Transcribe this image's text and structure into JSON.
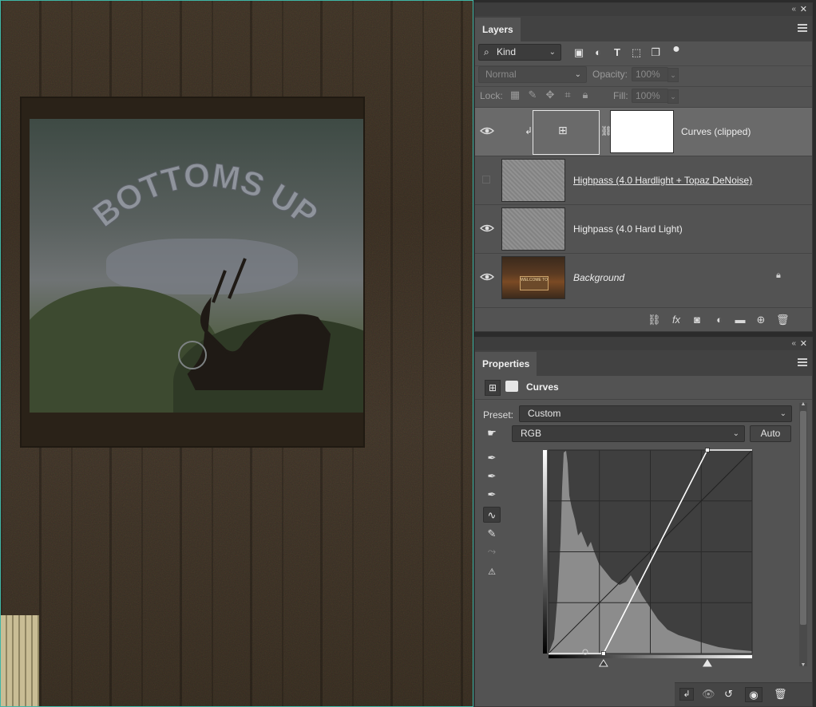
{
  "canvas": {
    "poster_text": "BOTTOMS UP"
  },
  "layers_panel": {
    "tab_label": "Layers",
    "filter_kind": "Kind",
    "blend_mode": "Normal",
    "opacity_label": "Opacity:",
    "opacity_value": "100%",
    "lock_label": "Lock:",
    "fill_label": "Fill:",
    "fill_value": "100%",
    "layers": [
      {
        "name": "Curves (clipped)",
        "visible": true,
        "selected": true
      },
      {
        "name": "Highpass (4.0 Hardlight + Topaz DeNoise)",
        "visible": false,
        "selected": false
      },
      {
        "name": "Highpass (4.0 Hard Light)",
        "visible": true,
        "selected": false
      },
      {
        "name": "Background",
        "visible": true,
        "selected": false,
        "locked": true
      }
    ],
    "background_thumb_text": "WELCOME TO"
  },
  "properties_panel": {
    "tab_label": "Properties",
    "adjustment_title": "Curves",
    "preset_label": "Preset:",
    "preset_value": "Custom",
    "channel_value": "RGB",
    "auto_label": "Auto",
    "curve_points": [
      [
        0.27,
        0.0
      ],
      [
        0.78,
        1.0
      ]
    ]
  },
  "colors": {
    "panel_bg": "#535353",
    "dark_bg": "#3c3c3c",
    "selected_layer": "#6a6a6a",
    "canvas_border": "#3fb7a7"
  }
}
